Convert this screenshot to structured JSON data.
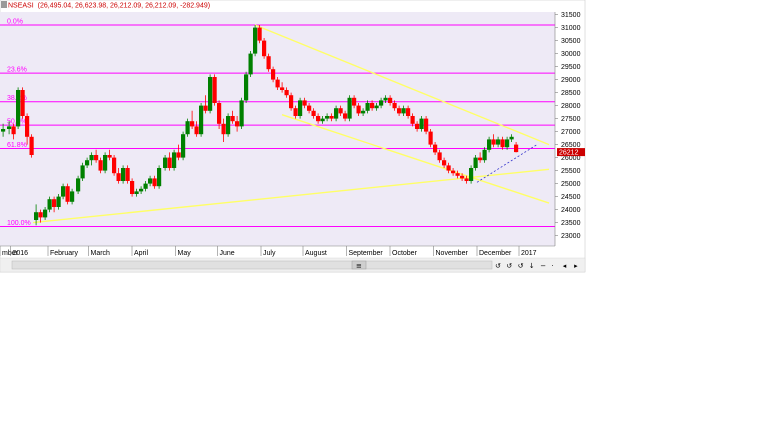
{
  "chart_data": {
    "type": "candlestick",
    "symbol": "NSEASI",
    "ohlc_header": "(26,495.04, 26,623.98, 26,212.09, 26,212.09, -282.949)",
    "last_value": "26212",
    "ylim": [
      22600,
      31600
    ],
    "y_ticks": [
      23000,
      23500,
      24000,
      24500,
      25000,
      25500,
      26000,
      26500,
      27000,
      27500,
      28000,
      28500,
      29000,
      29500,
      30000,
      30500,
      31000,
      31500
    ],
    "x_ticks": [
      {
        "label": "mber",
        "x": 0.0
      },
      {
        "label": "2016",
        "x": 0.7
      },
      {
        "label": "February",
        "x": 3.2
      },
      {
        "label": "March",
        "x": 5.9
      },
      {
        "label": "April",
        "x": 8.8
      },
      {
        "label": "May",
        "x": 11.7
      },
      {
        "label": "June",
        "x": 14.5
      },
      {
        "label": "July",
        "x": 17.4
      },
      {
        "label": "August",
        "x": 20.2
      },
      {
        "label": "September",
        "x": 23.1
      },
      {
        "label": "October",
        "x": 26.0
      },
      {
        "label": "November",
        "x": 28.9
      },
      {
        "label": "December",
        "x": 31.8
      },
      {
        "label": "2017",
        "x": 34.6
      }
    ],
    "fibonacci": [
      {
        "label": "0.0%",
        "value": 31100
      },
      {
        "label": "23.6%",
        "value": 29250
      },
      {
        "label": "38.2%",
        "value": 28150
      },
      {
        "label": "50.0%",
        "value": 27250
      },
      {
        "label": "61.8%",
        "value": 26350
      },
      {
        "label": "100.0%",
        "value": 23350
      }
    ],
    "trendlines": [
      {
        "x1": 17.0,
        "y1": 31100,
        "x2": 36.6,
        "y2": 26500
      },
      {
        "x1": 18.8,
        "y1": 27650,
        "x2": 36.6,
        "y2": 24250
      },
      {
        "x1": 2.2,
        "y1": 23500,
        "x2": 36.6,
        "y2": 25550
      }
    ],
    "dashed_lines": [
      {
        "x1": 31.8,
        "y1": 25050,
        "x2": 35.8,
        "y2": 26500
      }
    ],
    "ohlc": [
      [
        0.0,
        27000,
        27300,
        26800,
        27100
      ],
      [
        0.4,
        27100,
        27400,
        26900,
        27200
      ],
      [
        0.7,
        27200,
        27300,
        26700,
        26900
      ],
      [
        1.0,
        27200,
        28700,
        27100,
        28600
      ],
      [
        1.3,
        28600,
        28700,
        27500,
        27600
      ],
      [
        1.6,
        27600,
        27700,
        26500,
        26800
      ],
      [
        1.9,
        26800,
        26900,
        26000,
        26100
      ],
      [
        2.2,
        23600,
        24200,
        23400,
        23900
      ],
      [
        2.5,
        23900,
        24000,
        23500,
        23700
      ],
      [
        2.8,
        23700,
        24100,
        23600,
        24000
      ],
      [
        3.1,
        24000,
        24500,
        23900,
        24400
      ],
      [
        3.4,
        24400,
        24500,
        23900,
        24100
      ],
      [
        3.7,
        24100,
        24600,
        24000,
        24500
      ],
      [
        4.0,
        24500,
        25000,
        24400,
        24900
      ],
      [
        4.3,
        24900,
        25000,
        24200,
        24300
      ],
      [
        4.6,
        24300,
        24800,
        24200,
        24700
      ],
      [
        5.0,
        24700,
        25300,
        24600,
        25200
      ],
      [
        5.3,
        25200,
        25800,
        25100,
        25700
      ],
      [
        5.6,
        25700,
        26000,
        25600,
        25900
      ],
      [
        5.9,
        25900,
        26200,
        25700,
        26100
      ],
      [
        6.2,
        26100,
        26300,
        25800,
        25900
      ],
      [
        6.5,
        25900,
        26000,
        25400,
        25500
      ],
      [
        6.8,
        25500,
        26200,
        25400,
        26100
      ],
      [
        7.1,
        26100,
        26300,
        25900,
        26000
      ],
      [
        7.4,
        26000,
        26100,
        25300,
        25400
      ],
      [
        7.7,
        25400,
        25600,
        25000,
        25100
      ],
      [
        8.0,
        25100,
        25700,
        25000,
        25600
      ],
      [
        8.3,
        25600,
        25700,
        25000,
        25100
      ],
      [
        8.6,
        25100,
        25200,
        24500,
        24600
      ],
      [
        8.9,
        24600,
        24800,
        24500,
        24700
      ],
      [
        9.2,
        24700,
        24900,
        24600,
        24800
      ],
      [
        9.5,
        24800,
        25100,
        24700,
        25000
      ],
      [
        9.8,
        25000,
        25300,
        24900,
        25200
      ],
      [
        10.1,
        25200,
        25300,
        24800,
        24900
      ],
      [
        10.4,
        24900,
        25700,
        24800,
        25600
      ],
      [
        10.8,
        25600,
        26100,
        25500,
        26000
      ],
      [
        11.1,
        26000,
        26200,
        25500,
        25600
      ],
      [
        11.4,
        25600,
        26300,
        25500,
        26200
      ],
      [
        11.7,
        26200,
        26500,
        25900,
        26000
      ],
      [
        12.0,
        26000,
        27000,
        25900,
        26900
      ],
      [
        12.3,
        26900,
        27500,
        26800,
        27400
      ],
      [
        12.6,
        27400,
        27800,
        27100,
        27200
      ],
      [
        12.9,
        27200,
        27400,
        26800,
        26900
      ],
      [
        13.2,
        26900,
        28100,
        26800,
        28000
      ],
      [
        13.5,
        28000,
        28400,
        27700,
        27800
      ],
      [
        13.8,
        27800,
        29200,
        27700,
        29100
      ],
      [
        14.1,
        29100,
        29200,
        28000,
        28100
      ],
      [
        14.4,
        28100,
        28200,
        27100,
        27300
      ],
      [
        14.7,
        27300,
        27500,
        26600,
        26900
      ],
      [
        15.0,
        26900,
        27700,
        26800,
        27600
      ],
      [
        15.3,
        27600,
        27800,
        27300,
        27400
      ],
      [
        15.6,
        27400,
        27600,
        27000,
        27200
      ],
      [
        15.9,
        27200,
        28300,
        27100,
        28200
      ],
      [
        16.2,
        28200,
        29300,
        28100,
        29200
      ],
      [
        16.5,
        29200,
        30100,
        29100,
        30000
      ],
      [
        16.8,
        30000,
        31100,
        29900,
        31000
      ],
      [
        17.1,
        31000,
        31100,
        30400,
        30500
      ],
      [
        17.4,
        30500,
        30600,
        29800,
        29900
      ],
      [
        17.7,
        29900,
        30000,
        29300,
        29400
      ],
      [
        18.0,
        29400,
        29500,
        28900,
        29000
      ],
      [
        18.3,
        29000,
        29100,
        28600,
        28700
      ],
      [
        18.6,
        28700,
        28900,
        28500,
        28600
      ],
      [
        18.9,
        28600,
        28700,
        28300,
        28400
      ],
      [
        19.2,
        28400,
        28500,
        27800,
        27900
      ],
      [
        19.5,
        27900,
        28000,
        27500,
        27600
      ],
      [
        19.8,
        27600,
        28300,
        27500,
        28200
      ],
      [
        20.1,
        28200,
        28300,
        27900,
        28000
      ],
      [
        20.4,
        28000,
        28100,
        27700,
        27800
      ],
      [
        20.7,
        27800,
        27900,
        27500,
        27600
      ],
      [
        21.0,
        27600,
        27700,
        27300,
        27400
      ],
      [
        21.3,
        27400,
        27600,
        27300,
        27500
      ],
      [
        21.6,
        27500,
        27700,
        27400,
        27600
      ],
      [
        21.9,
        27600,
        27700,
        27400,
        27500
      ],
      [
        22.2,
        27500,
        28000,
        27400,
        27900
      ],
      [
        22.5,
        27900,
        28000,
        27600,
        27700
      ],
      [
        22.8,
        27700,
        27800,
        27400,
        27500
      ],
      [
        23.1,
        27500,
        28400,
        27400,
        28300
      ],
      [
        23.4,
        28300,
        28400,
        27900,
        28000
      ],
      [
        23.7,
        28000,
        28100,
        27600,
        27700
      ],
      [
        24.0,
        27700,
        27900,
        27600,
        27800
      ],
      [
        24.3,
        27800,
        28200,
        27700,
        28100
      ],
      [
        24.6,
        28100,
        28200,
        27800,
        27900
      ],
      [
        24.9,
        27900,
        28100,
        27800,
        28000
      ],
      [
        25.2,
        28000,
        28300,
        27900,
        28200
      ],
      [
        25.5,
        28200,
        28400,
        28100,
        28300
      ],
      [
        25.8,
        28300,
        28400,
        28000,
        28100
      ],
      [
        26.1,
        28100,
        28200,
        27800,
        27900
      ],
      [
        26.4,
        27900,
        28000,
        27600,
        27700
      ],
      [
        26.7,
        27700,
        28000,
        27600,
        27900
      ],
      [
        27.0,
        27900,
        28000,
        27500,
        27600
      ],
      [
        27.3,
        27600,
        27700,
        27200,
        27300
      ],
      [
        27.6,
        27300,
        27400,
        27000,
        27100
      ],
      [
        27.9,
        27100,
        27600,
        27000,
        27500
      ],
      [
        28.2,
        27500,
        27600,
        26900,
        27000
      ],
      [
        28.5,
        27000,
        27100,
        26400,
        26500
      ],
      [
        28.8,
        26500,
        26600,
        26100,
        26200
      ],
      [
        29.1,
        26200,
        26300,
        25800,
        25900
      ],
      [
        29.4,
        25900,
        26000,
        25600,
        25700
      ],
      [
        29.7,
        25700,
        25800,
        25400,
        25500
      ],
      [
        30.0,
        25500,
        25600,
        25300,
        25400
      ],
      [
        30.3,
        25400,
        25500,
        25200,
        25300
      ],
      [
        30.6,
        25300,
        25400,
        25100,
        25200
      ],
      [
        30.9,
        25200,
        25300,
        25000,
        25100
      ],
      [
        31.2,
        25100,
        25700,
        25000,
        25600
      ],
      [
        31.5,
        25600,
        26100,
        25500,
        26000
      ],
      [
        31.8,
        26000,
        26200,
        25800,
        25900
      ],
      [
        32.1,
        25900,
        26400,
        25800,
        26300
      ],
      [
        32.4,
        26300,
        26800,
        26200,
        26700
      ],
      [
        32.7,
        26700,
        26900,
        26400,
        26500
      ],
      [
        33.0,
        26500,
        26800,
        26400,
        26700
      ],
      [
        33.3,
        26700,
        26800,
        26300,
        26400
      ],
      [
        33.6,
        26400,
        26800,
        26300,
        26700
      ],
      [
        33.9,
        26700,
        26900,
        26600,
        26800
      ],
      [
        34.2,
        26500,
        26600,
        26200,
        26212
      ]
    ]
  },
  "toolbar": {
    "row1_glyphs": [
      "⋮",
      "▲",
      "▼",
      "▭",
      "○",
      "○",
      "◂",
      "▸"
    ],
    "row2_glyphs": [
      "↺",
      "↺",
      "↺",
      "↓",
      "−",
      "⋅",
      "◂",
      "▸"
    ],
    "scroll_glyph": "≡",
    "icon_names": [
      "scroll-handle-icon",
      "zoom-in-icon",
      "zoom-out-icon",
      "arrow-left-icon",
      "arrow-right-icon"
    ]
  },
  "colors": {
    "plot_background": "#eeeaf6",
    "up_candle": "#008000",
    "down_candle": "#ff0000",
    "fibonacci": "#ff00ff",
    "trendline": "#ffff66",
    "dashed": "#3333cc",
    "last_value_bg": "#cc0000"
  }
}
